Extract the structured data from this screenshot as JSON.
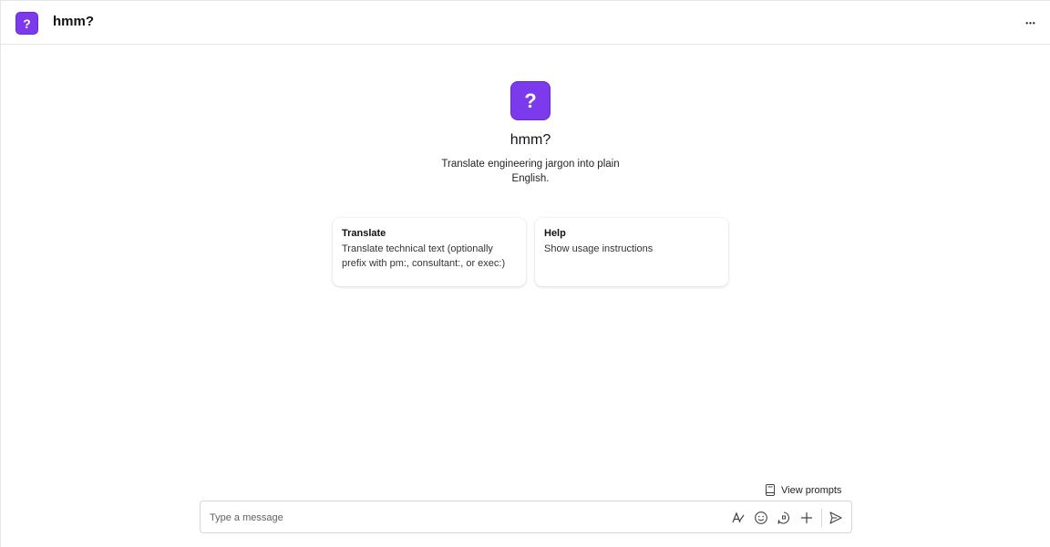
{
  "header": {
    "app_icon_glyph": "?",
    "title": "hmm?",
    "more_icon": "more-horizontal-icon",
    "more_glyph": "•••"
  },
  "bot": {
    "icon_glyph": "?",
    "name": "hmm?",
    "description": "Translate engineering jargon into plain English."
  },
  "cards": [
    {
      "title": "Translate",
      "text": "Translate technical text (optionally prefix with pm:, consultant:, or exec:)"
    },
    {
      "title": "Help",
      "text": "Show usage instructions"
    }
  ],
  "view_prompts": {
    "label": "View prompts",
    "icon": "book-icon"
  },
  "compose": {
    "placeholder": "Type a message",
    "tools": [
      "format-icon",
      "emoji-icon",
      "loop-icon",
      "add-icon",
      "send-icon"
    ]
  },
  "colors": {
    "accent": "#7c3aed",
    "border": "#e6e6e6"
  }
}
